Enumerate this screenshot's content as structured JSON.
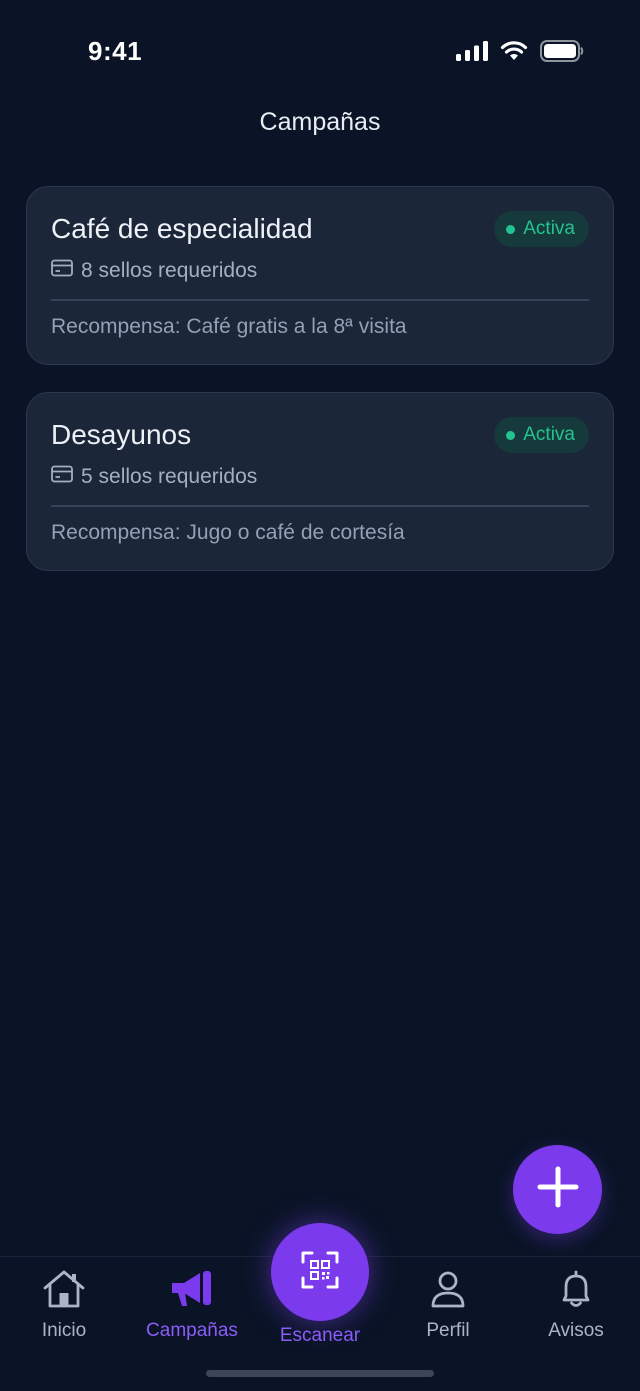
{
  "status_bar": {
    "time": "9:41",
    "icons": [
      "cellular-signal-icon",
      "wifi-icon",
      "battery-icon"
    ]
  },
  "header": {
    "title": "Campañas"
  },
  "campaigns": [
    {
      "title": "Café de especialidad",
      "status": "Activa",
      "stamps": "8 sellos requeridos",
      "reward": "Recompensa: Café gratis a la 8ª visita"
    },
    {
      "title": "Desayunos",
      "status": "Activa",
      "stamps": "5 sellos requeridos",
      "reward": "Recompensa: Jugo o café de cortesía"
    }
  ],
  "fab": {
    "icon": "plus-icon"
  },
  "tab_bar": {
    "items": [
      {
        "label": "Inicio",
        "icon": "home-icon",
        "active": false
      },
      {
        "label": "Campañas",
        "icon": "megaphone-icon",
        "active": true
      },
      {
        "label": "Escanear",
        "icon": "qr-scan-icon",
        "active": false
      },
      {
        "label": "Perfil",
        "icon": "user-icon",
        "active": false
      },
      {
        "label": "Avisos",
        "icon": "bell-icon",
        "active": false
      }
    ]
  },
  "colors": {
    "background": "#0a1426",
    "card": "#1b2638",
    "accent": "#7c3aed",
    "active_status": "#22c38e"
  }
}
